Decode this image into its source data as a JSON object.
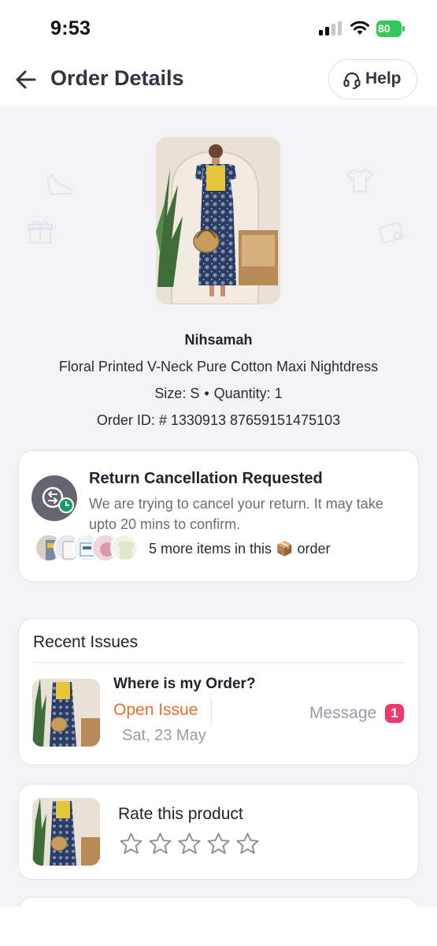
{
  "status_bar": {
    "time": "9:53",
    "battery": "80",
    "icons": [
      "cellular-signal-icon",
      "wifi-icon",
      "battery-charging-icon"
    ]
  },
  "header": {
    "title": "Order Details",
    "help_label": "Help",
    "icons": [
      "back-arrow-icon",
      "headset-icon"
    ]
  },
  "product": {
    "brand": "Nihsamah",
    "name": "Floral Printed V-Neck Pure Cotton Maxi Nightdress",
    "size": "Size: S",
    "separator": "•",
    "quantity": "Quantity: 1",
    "order_id": "Order ID: # 1330913 87659151475103"
  },
  "return_status": {
    "title": "Return Cancellation Requested",
    "description": "We are trying to cancel your return. It may take upto 20 mins to confirm.",
    "more_items_prefix": "5 more items in this",
    "more_items_icon": "📦",
    "more_items_suffix": "order"
  },
  "recent_issues": {
    "heading": "Recent Issues",
    "issue": {
      "question": "Where is my Order?",
      "status": "Open Issue",
      "date": "Sat, 23 May",
      "message_label": "Message",
      "message_count": "1"
    }
  },
  "rating": {
    "title": "Rate this product",
    "max_stars": 5,
    "current_rating": 0
  },
  "colors": {
    "accent_orange": "#f26b2a",
    "badge_pink": "#f0386b",
    "battery_green": "#34c759",
    "text_dark": "#23232f",
    "text_muted": "#9a9ba4"
  }
}
